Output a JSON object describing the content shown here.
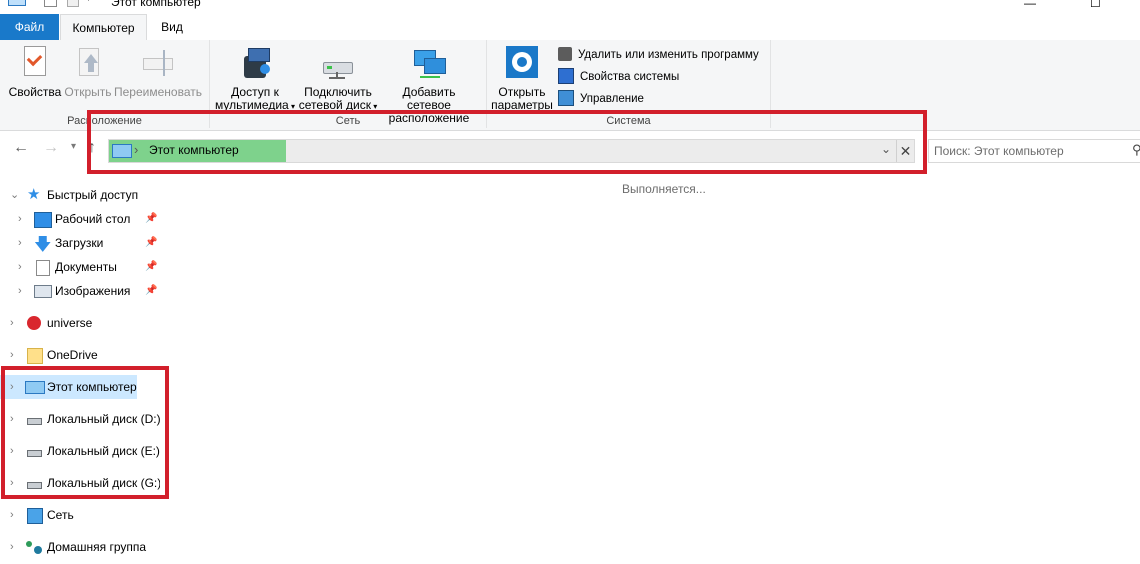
{
  "window": {
    "title": "Этот компьютер",
    "minimize": "—",
    "maximize": "☐"
  },
  "tabs": [
    {
      "label": "Файл",
      "active": false
    },
    {
      "label": "Компьютер",
      "active": true
    },
    {
      "label": "Вид",
      "active": false
    }
  ],
  "ribbon": {
    "groups": [
      {
        "label": "Расположение"
      },
      {
        "label": "Сеть"
      },
      {
        "label": "Система"
      }
    ],
    "buttons": {
      "properties": {
        "label": "Свойства",
        "icon": "properties-icon"
      },
      "open": {
        "label": "Открыть",
        "icon": "open-icon",
        "disabled": true
      },
      "rename": {
        "label": "Переименовать",
        "icon": "rename-icon",
        "disabled": true
      },
      "media": {
        "line1": "Доступ к",
        "line2": "мультимедиа",
        "icon": "media-icon"
      },
      "map_drive": {
        "line1": "Подключить",
        "line2": "сетевой диск",
        "icon": "network-drive-icon"
      },
      "add_location": {
        "line1": "Добавить сетевое",
        "line2": "расположение",
        "icon": "network-location-icon"
      },
      "open_settings": {
        "line1": "Открыть",
        "line2": "параметры",
        "icon": "settings-gear-icon"
      }
    },
    "system_items": [
      {
        "label": "Удалить или изменить программу",
        "icon": "uninstall-icon"
      },
      {
        "label": "Свойства системы",
        "icon": "system-properties-icon"
      },
      {
        "label": "Управление",
        "icon": "management-icon"
      }
    ]
  },
  "address": {
    "path_label": "Этот компьютер",
    "separator": "›",
    "progress_percent": 22,
    "search_placeholder": "Поиск: Этот компьютер"
  },
  "status": {
    "text": "Выполняется..."
  },
  "nav": [
    {
      "label": "Быстрый доступ",
      "icon": "star-icon",
      "pinned": false
    },
    {
      "label": "Рабочий стол",
      "icon": "desktop-icon",
      "pinned": true
    },
    {
      "label": "Загрузки",
      "icon": "download-icon",
      "pinned": true
    },
    {
      "label": "Документы",
      "icon": "documents-icon",
      "pinned": true
    },
    {
      "label": "Изображения",
      "icon": "pictures-icon",
      "pinned": true
    },
    {
      "label": "universe",
      "icon": "mega-icon",
      "pinned": false
    },
    {
      "label": "OneDrive",
      "icon": "folder-icon",
      "pinned": false
    },
    {
      "label": "Этот компьютер",
      "icon": "computer-icon",
      "selected": true
    },
    {
      "label": "Локальный диск (D:)",
      "icon": "drive-icon"
    },
    {
      "label": "Локальный диск (E:)",
      "icon": "drive-icon"
    },
    {
      "label": "Локальный диск (G:)",
      "icon": "drive-icon"
    },
    {
      "label": "Сеть",
      "icon": "network-icon"
    },
    {
      "label": "Домашняя группа",
      "icon": "homegroup-icon"
    }
  ],
  "colors": {
    "accent": "#1979ca",
    "highlight": "#d21f2b",
    "progress": "#7ed28c",
    "selection": "#cce8ff"
  }
}
